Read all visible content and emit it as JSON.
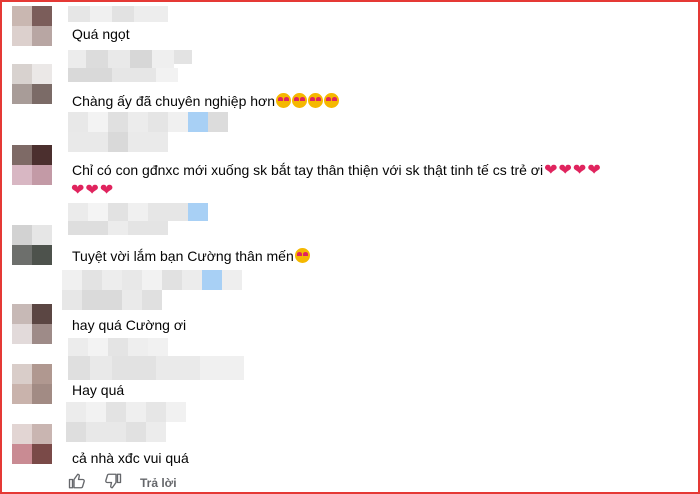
{
  "comments": [
    {
      "text": "Quá ngọt",
      "emojis": 0,
      "hearts": 0
    },
    {
      "text": "Chàng ấy đã chuyên nghiệp hơn",
      "emojis": 4,
      "hearts": 0
    },
    {
      "text": "Chỉ có con gđnxc mới xuống sk bắt tay thân thiện với sk thật tinh tế cs trẻ ơi",
      "emojis": 0,
      "hearts": 4,
      "text_line2_hearts": 3
    },
    {
      "text": "Tuyệt vời lắm bạn Cường thân mến",
      "emojis": 1,
      "hearts": 0
    },
    {
      "text": "hay quá Cường ơi",
      "emojis": 0,
      "hearts": 0
    },
    {
      "text": "Hay quá",
      "emojis": 0,
      "hearts": 0
    },
    {
      "text": "cả nhà xđc vui quá",
      "emojis": 0,
      "hearts": 0
    }
  ],
  "actions": {
    "reply_label": "Trả lời"
  },
  "icons": {
    "like": "thumbs-up-icon",
    "dislike": "thumbs-down-icon"
  },
  "colors": {
    "border": "#e53935",
    "heart": "#e0245e",
    "text": "#050505",
    "muted": "#65676b"
  }
}
